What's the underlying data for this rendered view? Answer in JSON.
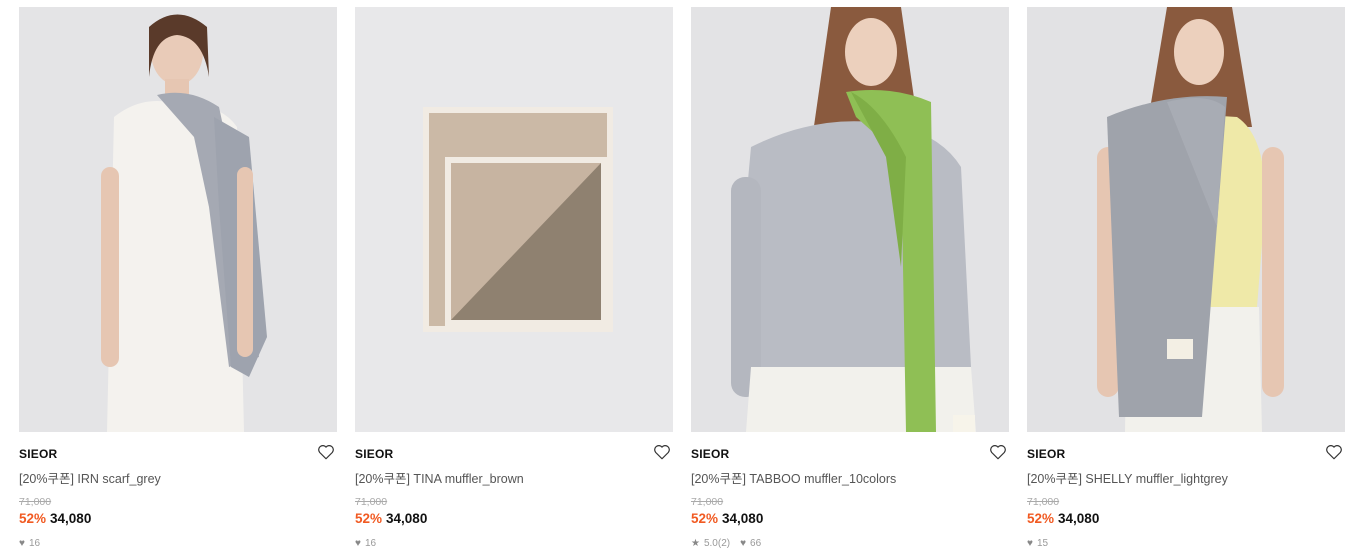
{
  "products": [
    {
      "brand": "SIEOR",
      "title": "[20%쿠폰] IRN scarf_grey",
      "original_price": "71,000",
      "discount": "52%",
      "price": "34,080",
      "rating": "",
      "likes": "16",
      "image": "model-grey-scarf"
    },
    {
      "brand": "SIEOR",
      "title": "[20%쿠폰] TINA muffler_brown",
      "original_price": "71,000",
      "discount": "52%",
      "price": "34,080",
      "rating": "",
      "likes": "16",
      "image": "folded-brown-muffler"
    },
    {
      "brand": "SIEOR",
      "title": "[20%쿠폰] TABBOO muffler_10colors",
      "original_price": "71,000",
      "discount": "52%",
      "price": "34,080",
      "rating": "5.0(2)",
      "likes": "66",
      "image": "model-green-muffler"
    },
    {
      "brand": "SIEOR",
      "title": "[20%쿠폰] SHELLY muffler_lightgrey",
      "original_price": "71,000",
      "discount": "52%",
      "price": "34,080",
      "rating": "",
      "likes": "15",
      "image": "model-lightgrey-muffler"
    }
  ],
  "colors": {
    "discount": "#f15a22",
    "price": "#111111",
    "muted": "#999999"
  }
}
